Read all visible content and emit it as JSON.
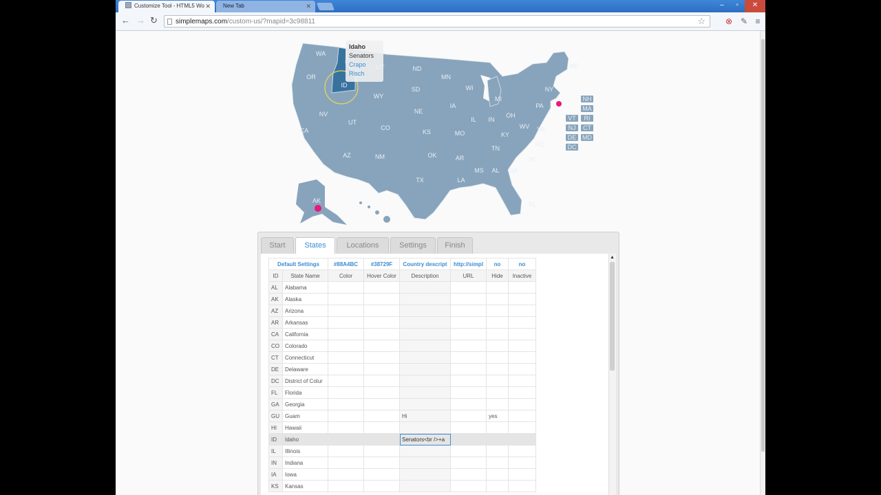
{
  "browser": {
    "tabs": [
      {
        "label": "Customize Tool - HTML5 Wo",
        "active": true
      },
      {
        "label": "New Tab",
        "active": false
      }
    ],
    "url_host": "simplemaps.com",
    "url_path": "/custom-us/?mapid=3c98811"
  },
  "map": {
    "tooltip": {
      "title": "Idaho",
      "line1": "Senators",
      "line2": "Crapo",
      "line3": "Risch"
    },
    "state_labels": [
      "WA",
      "OR",
      "ID",
      "WY",
      "MT",
      "ND",
      "SD",
      "NE",
      "MN",
      "WI",
      "MI",
      "IA",
      "IL",
      "IN",
      "OH",
      "PA",
      "NY",
      "ME",
      "NV",
      "CA",
      "UT",
      "CO",
      "KS",
      "MO",
      "KY",
      "WV",
      "VA",
      "AZ",
      "NM",
      "OK",
      "AR",
      "TN",
      "NC",
      "TX",
      "LA",
      "MS",
      "AL",
      "GA",
      "SC",
      "FL",
      "AK"
    ],
    "small_state_labels": [
      "NH",
      "MA",
      "VT",
      "RI",
      "NJ",
      "CT",
      "DE",
      "MD",
      "DC"
    ],
    "colors": {
      "state": "#88A4BC",
      "hover": "#38729F",
      "marker": "#e8197a"
    }
  },
  "editor": {
    "tabs": [
      "Start",
      "States",
      "Locations",
      "Settings",
      "Finish"
    ],
    "active_tab": "States",
    "defaults_row": [
      "Default Settings",
      "#88A4BC",
      "#38729F",
      "Country descript",
      "http://simpl",
      "no",
      "no"
    ],
    "headers": [
      "ID",
      "State Name",
      "Color",
      "Hover Color",
      "Description",
      "URL",
      "Hide",
      "Inactive"
    ],
    "rows": [
      {
        "id": "AL",
        "name": "Alabama",
        "desc": "",
        "hide": ""
      },
      {
        "id": "AK",
        "name": "Alaska",
        "desc": "",
        "hide": ""
      },
      {
        "id": "AZ",
        "name": "Arizona",
        "desc": "",
        "hide": ""
      },
      {
        "id": "AR",
        "name": "Arkansas",
        "desc": "",
        "hide": ""
      },
      {
        "id": "CA",
        "name": "California",
        "desc": "",
        "hide": ""
      },
      {
        "id": "CO",
        "name": "Colorado",
        "desc": "",
        "hide": ""
      },
      {
        "id": "CT",
        "name": "Connecticut",
        "desc": "",
        "hide": ""
      },
      {
        "id": "DE",
        "name": "Delaware",
        "desc": "",
        "hide": ""
      },
      {
        "id": "DC",
        "name": "District of Colur",
        "desc": "",
        "hide": ""
      },
      {
        "id": "FL",
        "name": "Florida",
        "desc": "",
        "hide": ""
      },
      {
        "id": "GA",
        "name": "Georgia",
        "desc": "",
        "hide": ""
      },
      {
        "id": "GU",
        "name": "Guam",
        "desc": "Hi",
        "hide": "yes"
      },
      {
        "id": "HI",
        "name": "Hawaii",
        "desc": "",
        "hide": ""
      },
      {
        "id": "ID",
        "name": "Idaho",
        "desc": "Senators<br />+a",
        "hide": ""
      },
      {
        "id": "IL",
        "name": "Illinois",
        "desc": "",
        "hide": ""
      },
      {
        "id": "IN",
        "name": "Indiana",
        "desc": "",
        "hide": ""
      },
      {
        "id": "IA",
        "name": "Iowa",
        "desc": "",
        "hide": ""
      },
      {
        "id": "KS",
        "name": "Kansas",
        "desc": "",
        "hide": ""
      }
    ]
  }
}
